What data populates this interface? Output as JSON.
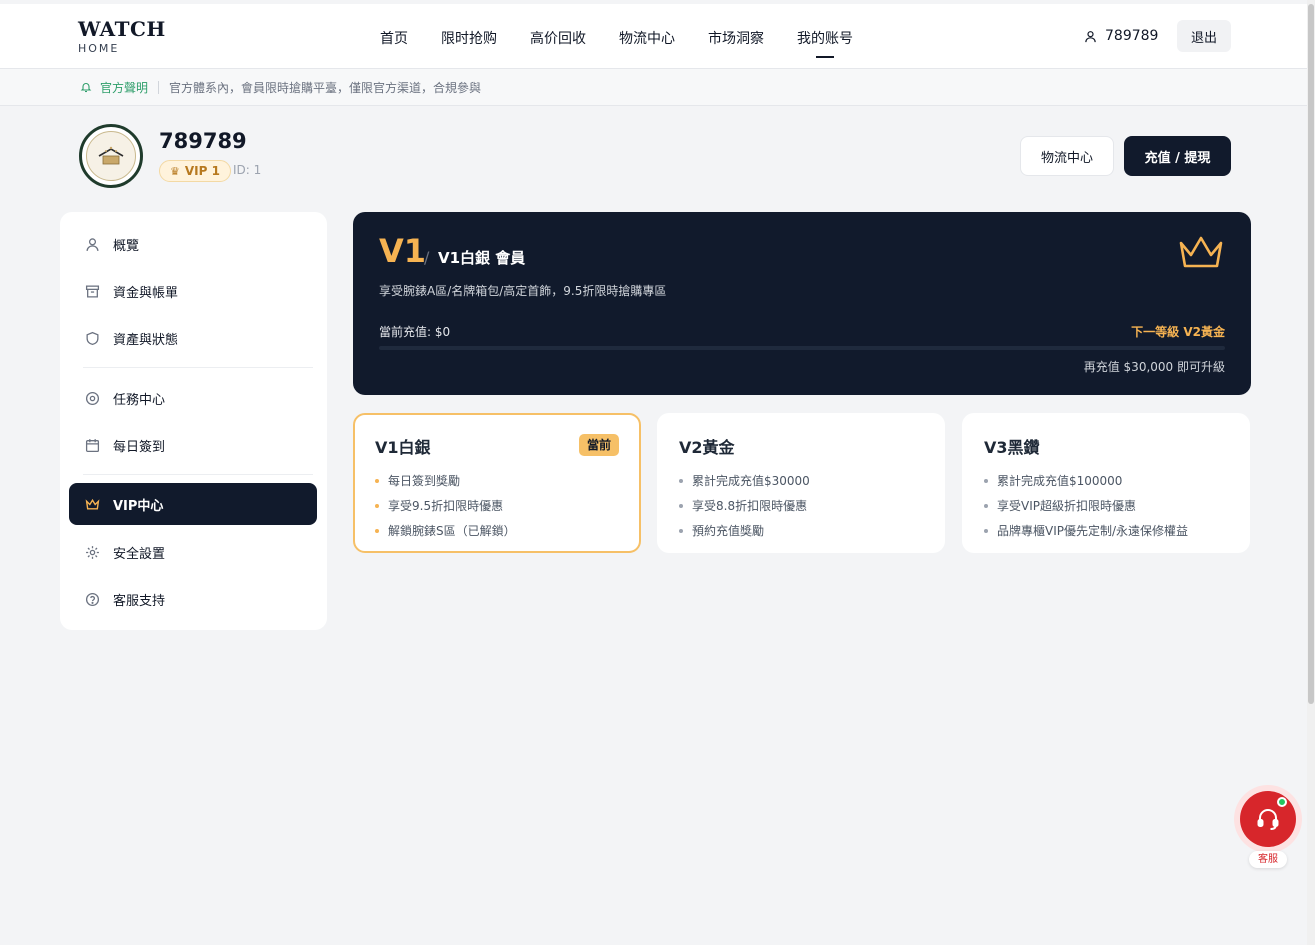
{
  "header": {
    "logo_main": "WATCH",
    "logo_sub": "HOME",
    "nav": [
      "首页",
      "限时抢购",
      "高价回收",
      "物流中心",
      "市场洞察",
      "我的账号"
    ],
    "active_nav": "我的账号",
    "username": "789789",
    "logout_label": "退出"
  },
  "notice": {
    "label": "官方聲明",
    "text": "官方體系內，會員限時搶購平臺，僅限官方渠道，合規參與"
  },
  "profile": {
    "name": "789789",
    "vip_label": "VIP 1",
    "id_label": "ID: 1",
    "logistics_button": "物流中心",
    "recharge_button": "充值 / 提現"
  },
  "sidebar": {
    "items": [
      {
        "label": "概覽",
        "icon": "user-icon"
      },
      {
        "label": "資金與帳單",
        "icon": "archive-icon"
      },
      {
        "label": "資產與狀態",
        "icon": "shield-icon"
      },
      {
        "label": "任務中心",
        "icon": "target-icon"
      },
      {
        "label": "每日簽到",
        "icon": "calendar-icon"
      },
      {
        "label": "VIP中心",
        "icon": "crown-icon"
      },
      {
        "label": "安全設置",
        "icon": "gear-icon"
      },
      {
        "label": "客服支持",
        "icon": "help-icon"
      }
    ],
    "active": "VIP中心"
  },
  "vip_banner": {
    "level": "V1",
    "title": "V1白銀 會員",
    "description": "享受腕錶A區/名牌箱包/高定首飾，9.5折限時搶購專區",
    "current_recharge": "當前充值: $0",
    "next_level": "下一等級 V2黃金",
    "upgrade_hint": "再充值 $30,000 即可升級",
    "progress": 0,
    "accent_color": "#f6b352",
    "bg_color": "#111a2c"
  },
  "tiers": [
    {
      "name": "V1白銀",
      "badge": "當前",
      "current": true,
      "benefits": [
        "每日簽到獎勵",
        "享受9.5折扣限時優惠",
        "解鎖腕錶S區（已解鎖）"
      ]
    },
    {
      "name": "V2黃金",
      "badge": "",
      "current": false,
      "benefits": [
        "累計完成充值$30000",
        "享受8.8折扣限時優惠",
        "預約充值獎勵"
      ]
    },
    {
      "name": "V3黑鑽",
      "badge": "",
      "current": false,
      "benefits": [
        "累計完成充值$100000",
        "享受VIP超級折扣限時優惠",
        "品牌專櫃VIP優先定制/永遠保修權益"
      ]
    }
  ],
  "support": {
    "label": "客服",
    "icon": "headset-icon"
  }
}
